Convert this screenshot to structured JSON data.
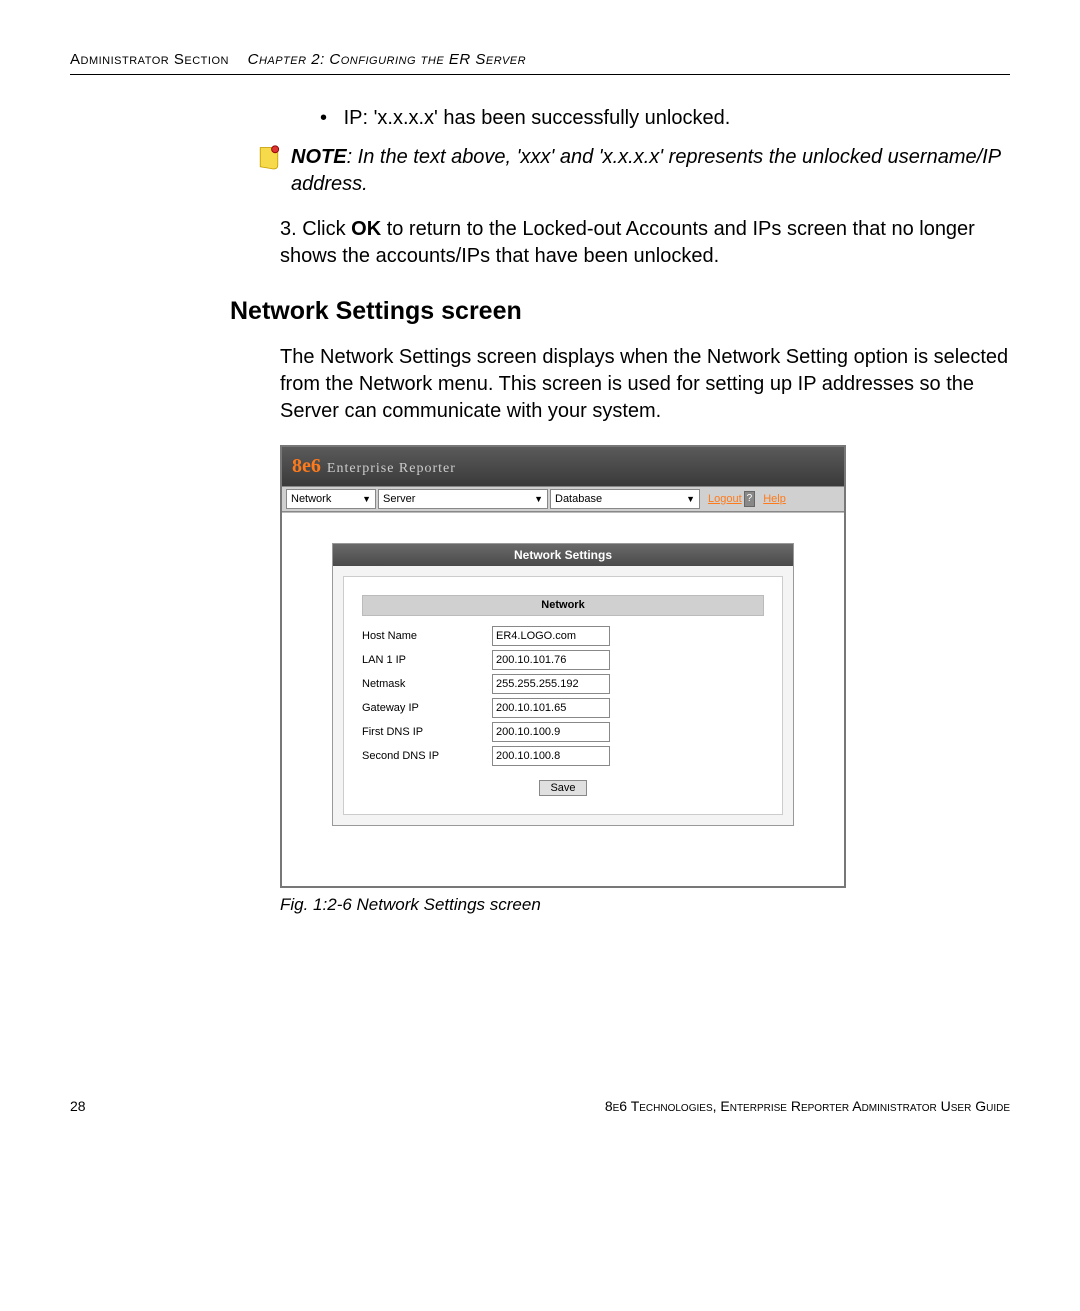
{
  "header": {
    "section": "Administrator Section",
    "chapter": "Chapter 2: Configuring the ER Server"
  },
  "bullet": {
    "text": "IP: 'x.x.x.x' has been successfully unlocked."
  },
  "note": {
    "label": "NOTE",
    "text": ": In the text above, 'xxx' and 'x.x.x.x' represents the unlocked username/IP address."
  },
  "step3": {
    "number": "3.",
    "pre": " Click ",
    "bold": "OK",
    "post": " to return to the Locked-out Accounts and IPs screen that no longer shows the accounts/IPs that have been unlocked."
  },
  "section_heading": "Network Settings screen",
  "section_para": "The Network Settings screen displays when the Network Setting option is selected from the Network menu. This screen is used for setting up IP addresses so the Server can communicate with your system.",
  "figure_caption": "Fig. 1:2-6  Network Settings screen",
  "app": {
    "brand_main": "8e6",
    "brand_sub": "Enterprise Reporter",
    "menus": {
      "network": "Network",
      "server": "Server",
      "database": "Database"
    },
    "links": {
      "logout": "Logout",
      "help": "Help",
      "help_badge": "?"
    },
    "panel_title": "Network Settings",
    "sub_title": "Network",
    "fields": {
      "hostname_label": "Host Name",
      "hostname_value": "ER4.LOGO.com",
      "lan1_label": "LAN 1 IP",
      "lan1_value": "200.10.101.76",
      "netmask_label": "Netmask",
      "netmask_value": "255.255.255.192",
      "gateway_label": "Gateway IP",
      "gateway_value": "200.10.101.65",
      "dns1_label": "First DNS IP",
      "dns1_value": "200.10.100.9",
      "dns2_label": "Second DNS IP",
      "dns2_value": "200.10.100.8"
    },
    "save_label": "Save"
  },
  "footer": {
    "page_number": "28",
    "text": "8e6 Technologies, Enterprise Reporter Administrator User Guide"
  }
}
